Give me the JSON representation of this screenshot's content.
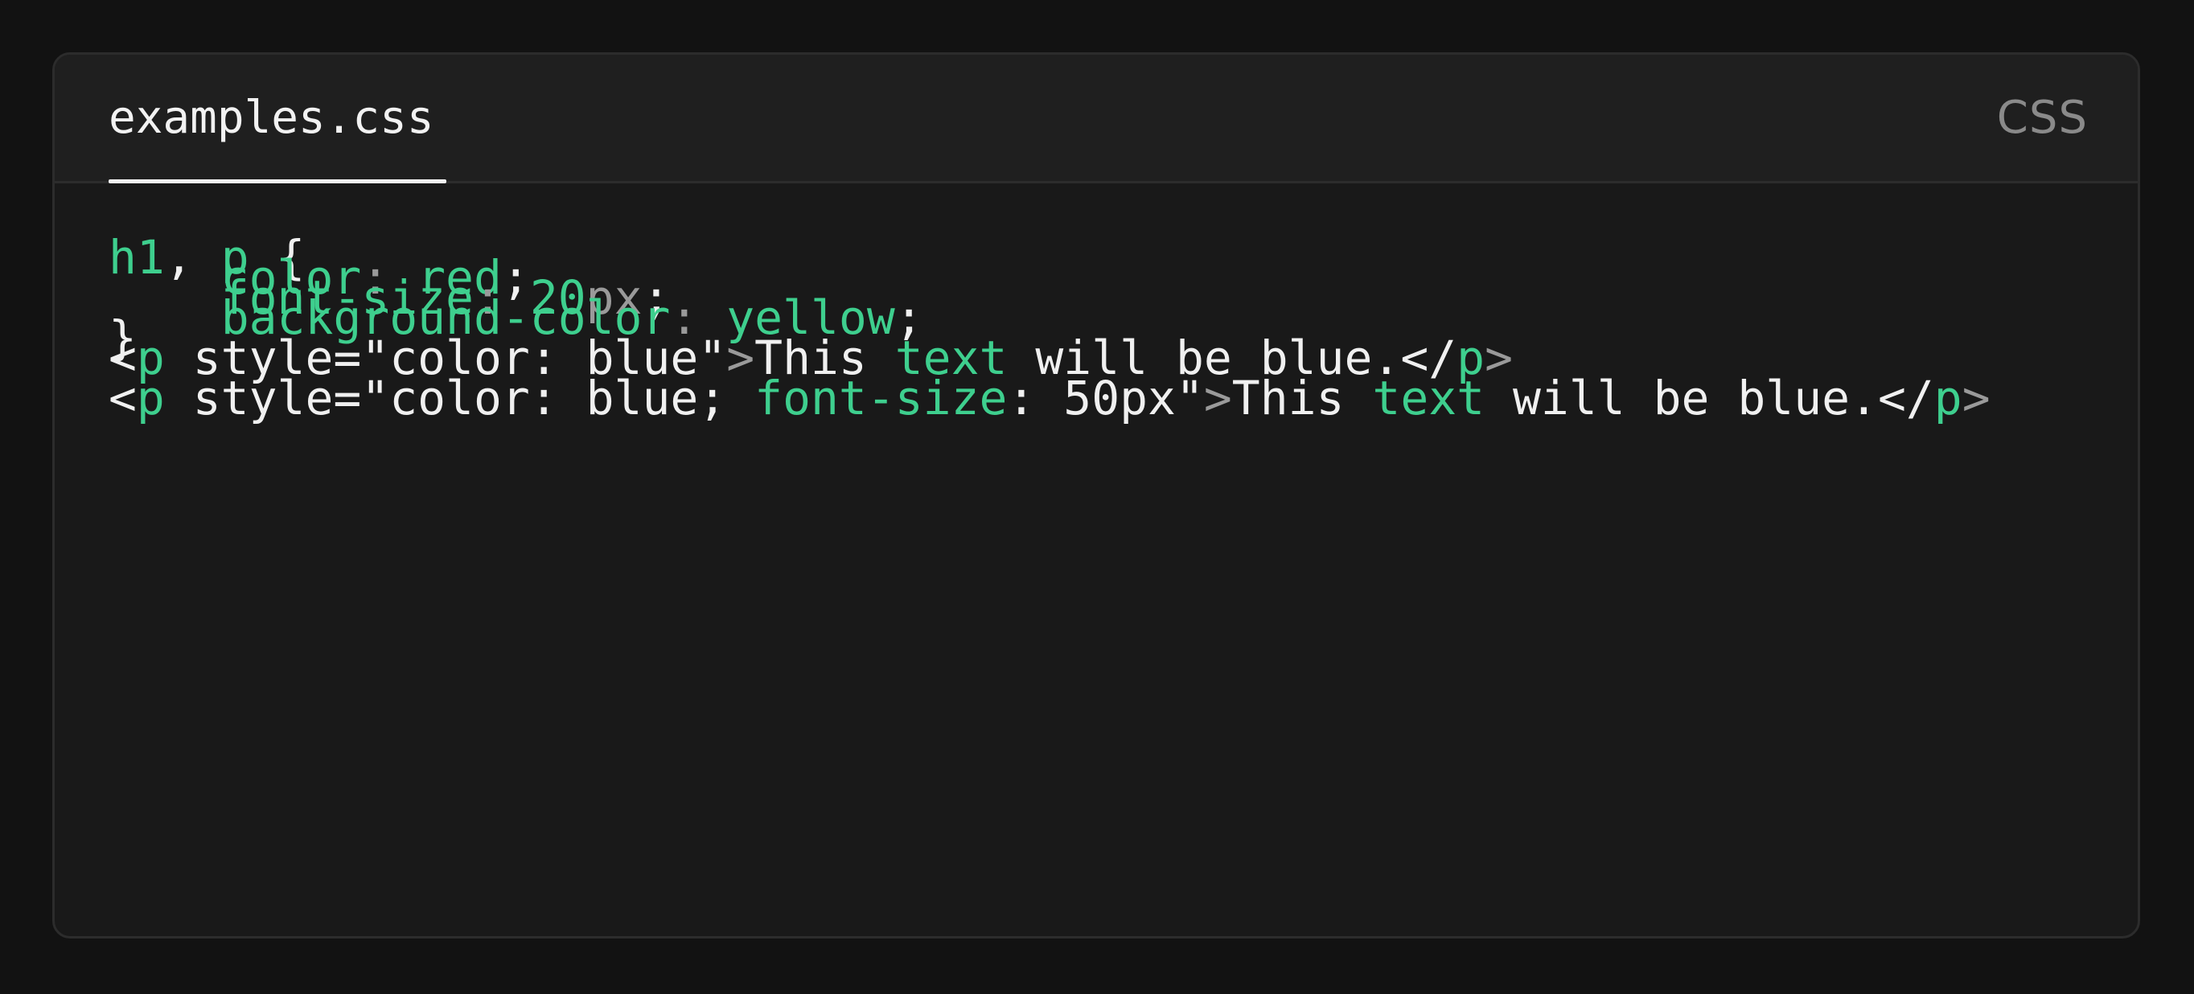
{
  "file_tab": {
    "label": "examples.css"
  },
  "language": "CSS",
  "colors": {
    "background": "#121212",
    "card": "#191919",
    "header": "#1f1f1f",
    "accent_green": "#3ecf8e",
    "muted": "#9a9a9a",
    "text": "#f0f0f0"
  },
  "code": {
    "line1": {
      "sel1": "h1",
      "comma": ",",
      "sel2": "p",
      "brace": "{"
    },
    "line2": {
      "indent": "    ",
      "prop": "color",
      "colon": ":",
      "value": "red",
      "semi": ";"
    },
    "line3": {
      "indent": "    ",
      "prop": "font-size",
      "colon": ":",
      "num": "20",
      "unit": "px",
      "semi": ";"
    },
    "line4": {
      "indent": "    ",
      "prop": "background-color",
      "colon": ":",
      "value": "yellow",
      "semi": ";"
    },
    "line5": {
      "brace": "}"
    },
    "line6": {
      "lt": "<",
      "tag": "p",
      "attr": " style=\"color: blue\"",
      "gt": ">",
      "text1": "This ",
      "kw": "text",
      "text2": " will be blue.</",
      "close_tag": "p",
      "close_gt": ">"
    },
    "line8": {
      "lt": "<",
      "tag": "p",
      "attr1": " style=\"color: blue; ",
      "kw1": "font-size",
      "attr2": ": 50px\"",
      "gt": ">",
      "text1": "This ",
      "kw2": "text",
      "text2": " will be blue.</",
      "close_tag": "p",
      "close_gt": ">"
    }
  }
}
